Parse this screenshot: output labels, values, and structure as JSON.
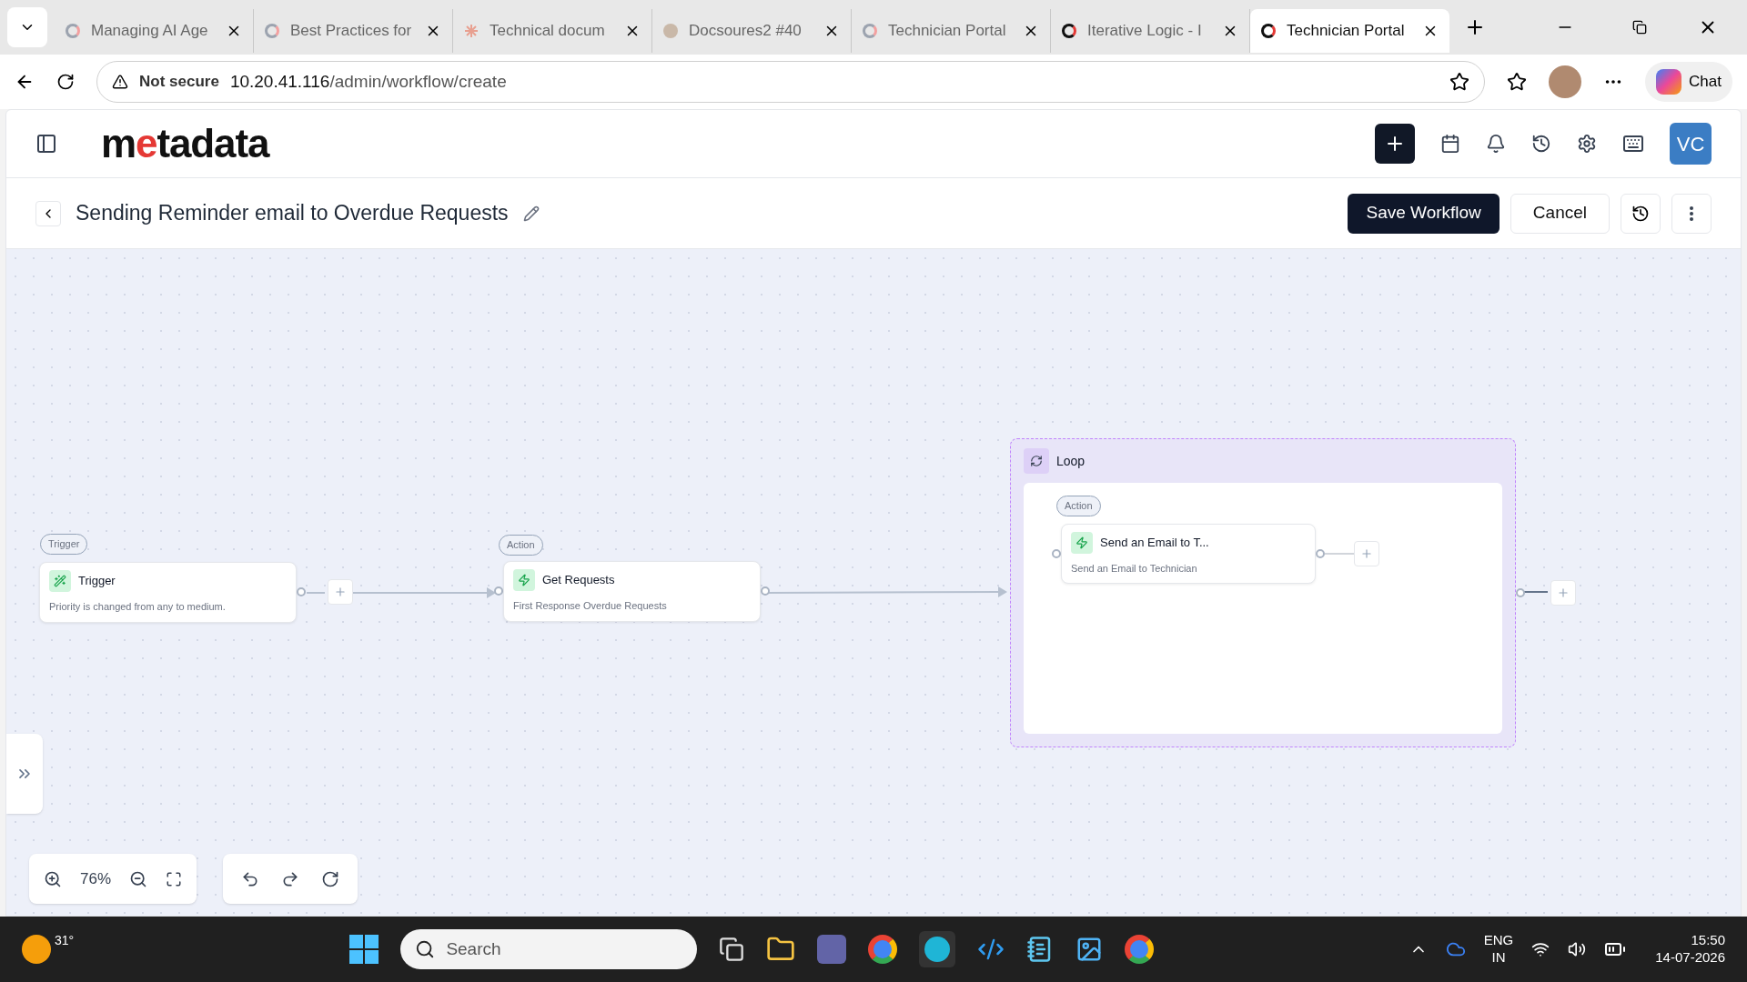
{
  "browser": {
    "tabs": [
      {
        "label": "Managing AI Age",
        "selected": false,
        "kind": "ring"
      },
      {
        "label": "Best Practices for",
        "selected": false,
        "kind": "ring"
      },
      {
        "label": "Technical docum",
        "selected": false,
        "kind": "spark"
      },
      {
        "label": "Docsoures2 #40",
        "selected": false,
        "kind": "avatar"
      },
      {
        "label": "Technician Portal",
        "selected": false,
        "kind": "ring"
      },
      {
        "label": "Iterative Logic - I",
        "selected": false,
        "kind": "dark"
      },
      {
        "label": "Technician Portal",
        "selected": true,
        "kind": "dark"
      }
    ],
    "security": "Not secure",
    "url_host": "10.20.41.116",
    "url_path": "/admin/workflow/create",
    "chat": "Chat"
  },
  "app": {
    "logo": "metadata",
    "avatar": "VC"
  },
  "workflow": {
    "title": "Sending Reminder email to Overdue Requests",
    "save": "Save Workflow",
    "cancel": "Cancel"
  },
  "canvas": {
    "trigger": {
      "badge": "Trigger",
      "title": "Trigger",
      "description": "Priority is changed from any to medium."
    },
    "action": {
      "badge": "Action",
      "title": "Get Requests",
      "description": "First Response Overdue Requests"
    },
    "loop": {
      "title": "Loop",
      "action": {
        "badge": "Action",
        "title": "Send an Email to T...",
        "description": "Send an Email to Technician"
      }
    },
    "zoom": "76%"
  },
  "taskbar": {
    "temperature": "31°",
    "search": "Search",
    "language": "ENG",
    "region": "IN",
    "time": "15:50",
    "date": "14-07-2026"
  }
}
